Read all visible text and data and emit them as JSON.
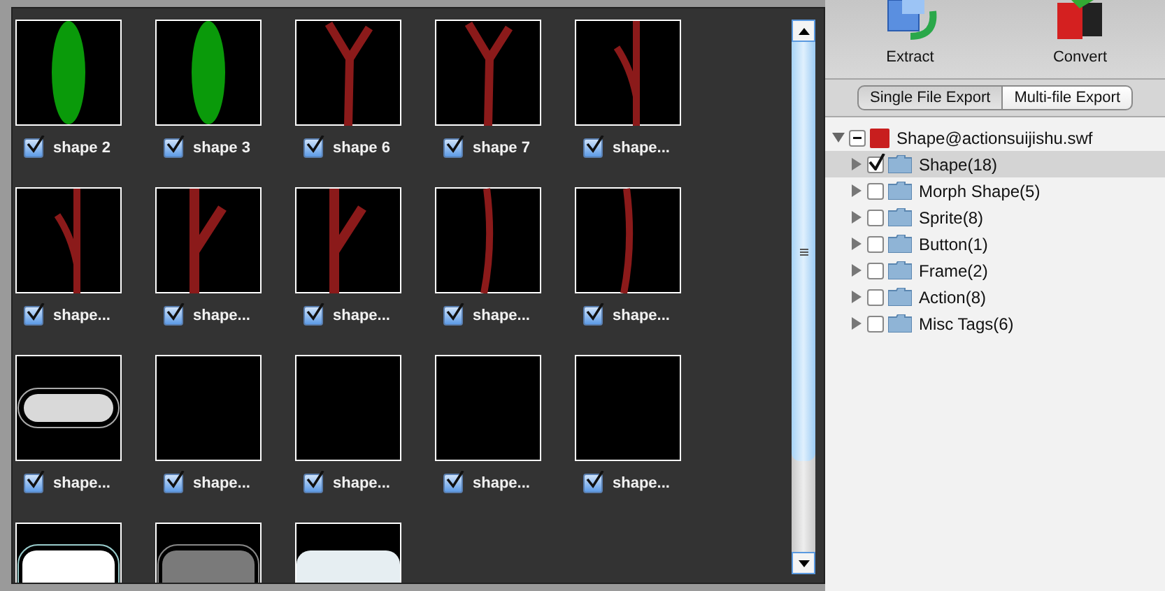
{
  "thumbnails": [
    {
      "kind": "ellipse",
      "label": "shape 2",
      "checked": true
    },
    {
      "kind": "ellipse",
      "label": "shape 3",
      "checked": true
    },
    {
      "kind": "fork",
      "label": "shape 6",
      "checked": true
    },
    {
      "kind": "fork",
      "label": "shape 7",
      "checked": true
    },
    {
      "kind": "left-branch",
      "label": "shape...",
      "checked": true
    },
    {
      "kind": "left-branch",
      "label": "shape...",
      "checked": true
    },
    {
      "kind": "right-branch",
      "label": "shape...",
      "checked": true
    },
    {
      "kind": "right-branch",
      "label": "shape...",
      "checked": true
    },
    {
      "kind": "curve",
      "label": "shape...",
      "checked": true
    },
    {
      "kind": "curve",
      "label": "shape...",
      "checked": true
    },
    {
      "kind": "pill",
      "label": "shape...",
      "checked": true
    },
    {
      "kind": "empty",
      "label": "shape...",
      "checked": true
    },
    {
      "kind": "empty",
      "label": "shape...",
      "checked": true
    },
    {
      "kind": "empty",
      "label": "shape...",
      "checked": true
    },
    {
      "kind": "empty",
      "label": "shape...",
      "checked": true
    },
    {
      "kind": "pill-white"
    },
    {
      "kind": "pill-gray"
    },
    {
      "kind": "pill-light"
    }
  ],
  "toolbar": [
    {
      "label": "Extract",
      "kind": "extract"
    },
    {
      "label": "Convert",
      "kind": "convert"
    }
  ],
  "export_tabs": [
    {
      "label": "Single File Export",
      "selected": true
    },
    {
      "label": "Multi-file Export",
      "selected": false
    }
  ],
  "tree": {
    "root": {
      "label": "Shape@actionsuijishu.swf",
      "expanded": true,
      "partial": true
    },
    "children": [
      {
        "label": "Shape(18)",
        "checked": true,
        "selected": true
      },
      {
        "label": "Morph Shape(5)",
        "checked": false,
        "selected": false
      },
      {
        "label": "Sprite(8)",
        "checked": false,
        "selected": false
      },
      {
        "label": "Button(1)",
        "checked": false,
        "selected": false
      },
      {
        "label": "Frame(2)",
        "checked": false,
        "selected": false
      },
      {
        "label": "Action(8)",
        "checked": false,
        "selected": false
      },
      {
        "label": "Misc Tags(6)",
        "checked": false,
        "selected": false
      }
    ]
  }
}
